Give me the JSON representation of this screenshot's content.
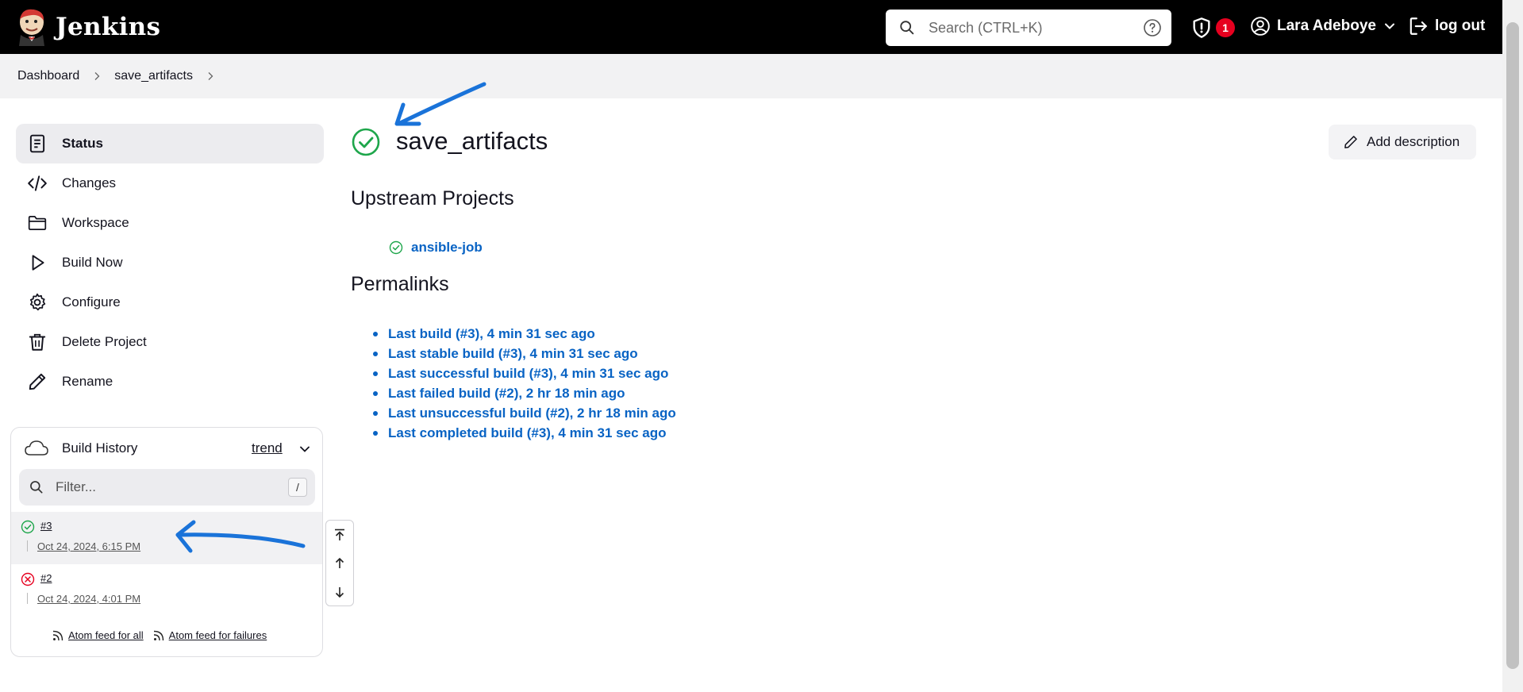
{
  "header": {
    "app_name": "Jenkins",
    "search_placeholder": "Search (CTRL+K)",
    "security_badge_count": "1",
    "user_name": "Lara Adeboye",
    "logout_label": "log out"
  },
  "breadcrumb": [
    "Dashboard",
    "save_artifacts"
  ],
  "sidebar": {
    "tasks": [
      {
        "label": "Status",
        "icon": "document-icon",
        "active": true
      },
      {
        "label": "Changes",
        "icon": "code-icon"
      },
      {
        "label": "Workspace",
        "icon": "folder-icon"
      },
      {
        "label": "Build Now",
        "icon": "play-icon"
      },
      {
        "label": "Configure",
        "icon": "gear-icon"
      },
      {
        "label": "Delete Project",
        "icon": "trash-icon"
      },
      {
        "label": "Rename",
        "icon": "pencil-icon"
      }
    ]
  },
  "build_history": {
    "title": "Build History",
    "trend_label": "trend",
    "filter_placeholder": "Filter...",
    "filter_shortcut": "/",
    "builds": [
      {
        "number": "#3",
        "date": "Oct 24, 2024, 6:15 PM",
        "status": "success"
      },
      {
        "number": "#2",
        "date": "Oct 24, 2024, 4:01 PM",
        "status": "failed"
      }
    ],
    "feeds": [
      "Atom feed for all",
      "Atom feed for failures"
    ]
  },
  "main": {
    "project_title": "save_artifacts",
    "add_description_label": "Add description",
    "upstream_heading": "Upstream Projects",
    "upstream_projects": [
      {
        "name": "ansible-job",
        "status": "success"
      }
    ],
    "permalinks_heading": "Permalinks",
    "permalinks": [
      "Last build (#3), 4 min 31 sec ago",
      "Last stable build (#3), 4 min 31 sec ago",
      "Last successful build (#3), 4 min 31 sec ago",
      "Last failed build (#2), 2 hr 18 min ago",
      "Last unsuccessful build (#2), 2 hr 18 min ago",
      "Last completed build (#3), 4 min 31 sec ago"
    ]
  },
  "colors": {
    "success": "#1ea64b",
    "failed": "#e6001f",
    "link": "#0863c4",
    "annotation": "#1a73d9"
  }
}
